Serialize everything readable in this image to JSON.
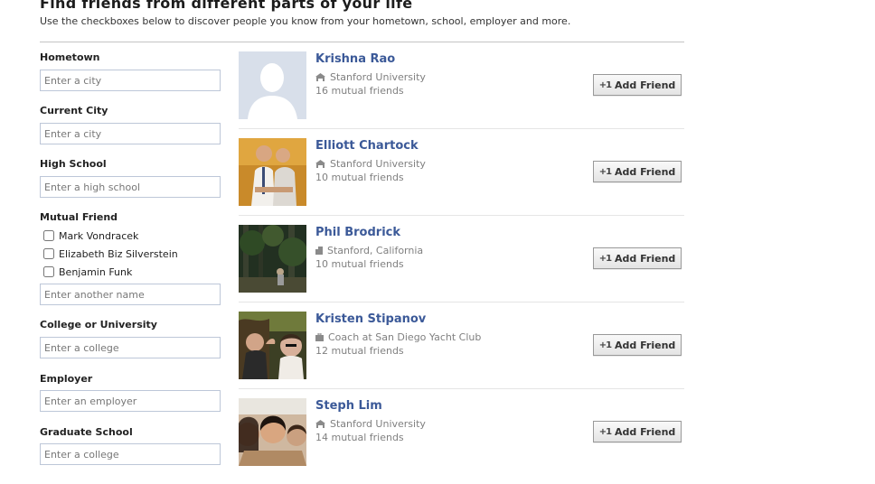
{
  "header": {
    "title": "Find friends from different parts of your life",
    "subtitle": "Use the checkboxes below to discover people you know from your hometown, school, employer and more."
  },
  "filters": {
    "hometown": {
      "label": "Hometown",
      "placeholder": "Enter a city"
    },
    "current_city": {
      "label": "Current City",
      "placeholder": "Enter a city"
    },
    "high_school": {
      "label": "High School",
      "placeholder": "Enter a high school"
    },
    "mutual_friend": {
      "label": "Mutual Friend",
      "options": [
        "Mark Vondracek",
        "Elizabeth Biz Silverstein",
        "Benjamin Funk"
      ],
      "placeholder": "Enter another name"
    },
    "college": {
      "label": "College or University",
      "placeholder": "Enter a college"
    },
    "employer": {
      "label": "Employer",
      "placeholder": "Enter an employer"
    },
    "graduate_school": {
      "label": "Graduate School",
      "placeholder": "Enter a college"
    }
  },
  "results": [
    {
      "name": "Krishna Rao",
      "detail": "Stanford University",
      "detail_icon": "school-icon",
      "mutual": "16 mutual friends",
      "button": "Add Friend"
    },
    {
      "name": "Elliott Chartock",
      "detail": "Stanford University",
      "detail_icon": "school-icon",
      "mutual": "10 mutual friends",
      "button": "Add Friend"
    },
    {
      "name": "Phil Brodrick",
      "detail": "Stanford, California",
      "detail_icon": "city-icon",
      "mutual": "10 mutual friends",
      "button": "Add Friend"
    },
    {
      "name": "Kristen Stipanov",
      "detail": "Coach at San Diego Yacht Club",
      "detail_icon": "briefcase-icon",
      "mutual": "12 mutual friends",
      "button": "Add Friend"
    },
    {
      "name": "Steph Lim",
      "detail": "Stanford University",
      "detail_icon": "school-icon",
      "mutual": "14 mutual friends",
      "button": "Add Friend"
    }
  ],
  "colors": {
    "link": "#3b5998",
    "muted": "#808080",
    "divider": "#c4c4c4"
  }
}
